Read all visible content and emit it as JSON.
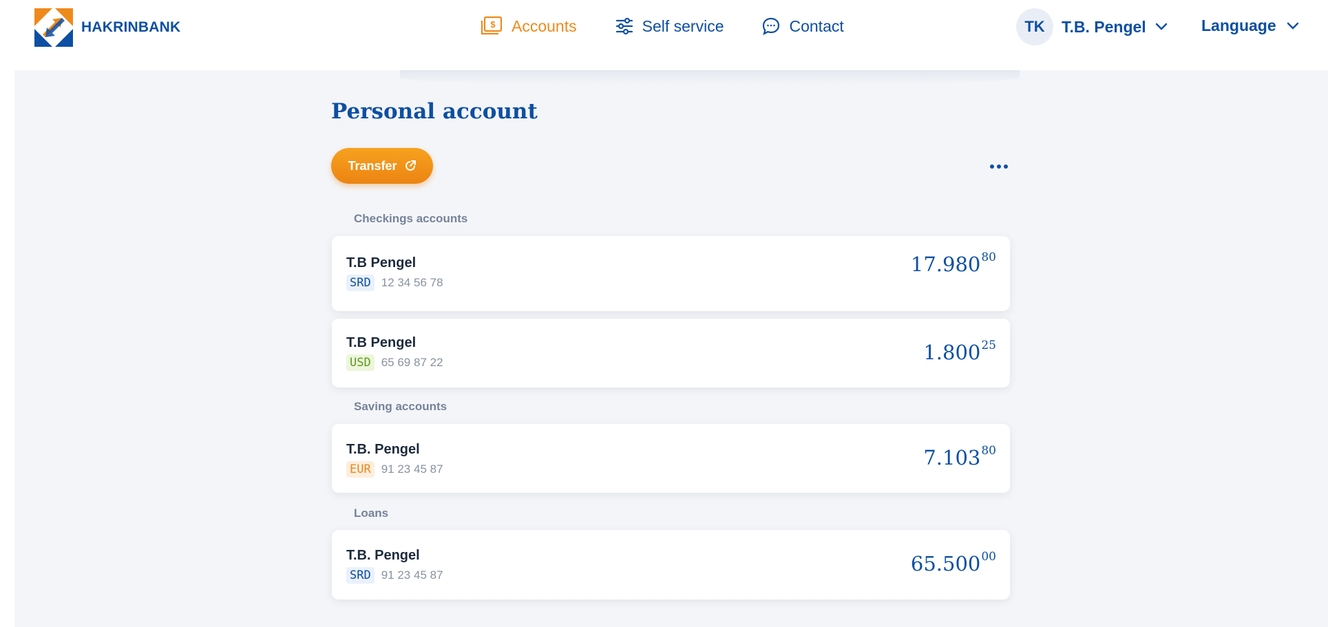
{
  "brand": {
    "name": "HAKRINBANK",
    "colors": {
      "primary": "#0d4fa3",
      "accent": "#ee8a1b"
    }
  },
  "nav": [
    {
      "label": "Accounts",
      "icon": "money-icon",
      "active": true
    },
    {
      "label": "Self service",
      "icon": "sliders-icon",
      "active": false
    },
    {
      "label": "Contact",
      "icon": "chat-icon",
      "active": false
    }
  ],
  "user": {
    "initials": "TK",
    "name": "T.B. Pengel"
  },
  "language": {
    "label": "Language"
  },
  "page": {
    "title": "Personal account",
    "transfer_label": "Transfer"
  },
  "sections": {
    "checkings": "Checkings accounts",
    "savings": "Saving accounts",
    "loans": "Loans"
  },
  "accounts": [
    {
      "name": "T.B Pengel",
      "currency": "SRD",
      "number": "12 34 56 78",
      "amount_main": "17.980",
      "amount_cents": "80"
    },
    {
      "name": "T.B Pengel",
      "currency": "USD",
      "number": "65 69 87 22",
      "amount_main": "1.800",
      "amount_cents": "25"
    },
    {
      "name": "T.B. Pengel",
      "currency": "EUR",
      "number": "91 23 45 87",
      "amount_main": "7.103",
      "amount_cents": "80"
    },
    {
      "name": "T.B. Pengel",
      "currency": "SRD",
      "number": "91 23 45 87",
      "amount_main": "65.500",
      "amount_cents": "00"
    }
  ]
}
